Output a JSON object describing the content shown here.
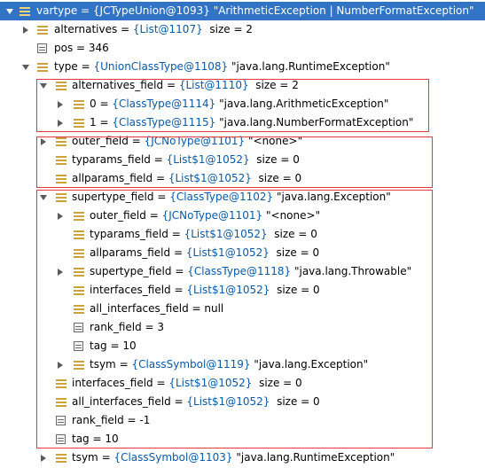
{
  "rows": [
    {
      "name": "vartype",
      "type": "{JCTypeUnion@1093}",
      "value": "\"ArithmeticException | NumberFormatException\""
    },
    {
      "name": "alternatives",
      "type": "{List@1107}",
      "value": "size = 2"
    },
    {
      "name": "pos",
      "value": "346"
    },
    {
      "name": "type",
      "type": "{UnionClassType@1108}",
      "value": "\"java.lang.RuntimeException\""
    },
    {
      "name": "alternatives_field",
      "type": "{List@1110}",
      "value": "size = 2"
    },
    {
      "name": "0",
      "type": "{ClassType@1114}",
      "value": "\"java.lang.ArithmeticException\""
    },
    {
      "name": "1",
      "type": "{ClassType@1115}",
      "value": "\"java.lang.NumberFormatException\""
    },
    {
      "name": "outer_field",
      "type": "{JCNoType@1101}",
      "value": "\"<none>\""
    },
    {
      "name": "typarams_field",
      "type": "{List$1@1052}",
      "value": "size = 0"
    },
    {
      "name": "allparams_field",
      "type": "{List$1@1052}",
      "value": "size = 0"
    },
    {
      "name": "supertype_field",
      "type": "{ClassType@1102}",
      "value": "\"java.lang.Exception\""
    },
    {
      "name": "outer_field",
      "type": "{JCNoType@1101}",
      "value": "\"<none>\""
    },
    {
      "name": "typarams_field",
      "type": "{List$1@1052}",
      "value": "size = 0"
    },
    {
      "name": "allparams_field",
      "type": "{List$1@1052}",
      "value": "size = 0"
    },
    {
      "name": "supertype_field",
      "type": "{ClassType@1118}",
      "value": "\"java.lang.Throwable\""
    },
    {
      "name": "interfaces_field",
      "type": "{List$1@1052}",
      "value": "size = 0"
    },
    {
      "name": "all_interfaces_field",
      "value": "null"
    },
    {
      "name": "rank_field",
      "value": "3"
    },
    {
      "name": "tag",
      "value": "10"
    },
    {
      "name": "tsym",
      "type": "{ClassSymbol@1119}",
      "value": "\"java.lang.Exception\""
    },
    {
      "name": "interfaces_field",
      "type": "{List$1@1052}",
      "value": "size = 0"
    },
    {
      "name": "all_interfaces_field",
      "type": "{List$1@1052}",
      "value": "size = 0"
    },
    {
      "name": "rank_field",
      "value": "-1"
    },
    {
      "name": "tag",
      "value": "10"
    },
    {
      "name": "tsym",
      "type": "{ClassSymbol@1103}",
      "value": "\"java.lang.RuntimeException\""
    }
  ],
  "colors": {
    "selection": "#3174c5",
    "type_ref": "#0a5aa8",
    "highlight_box": "#e33b3b",
    "field_icon": "#c9a43c"
  }
}
